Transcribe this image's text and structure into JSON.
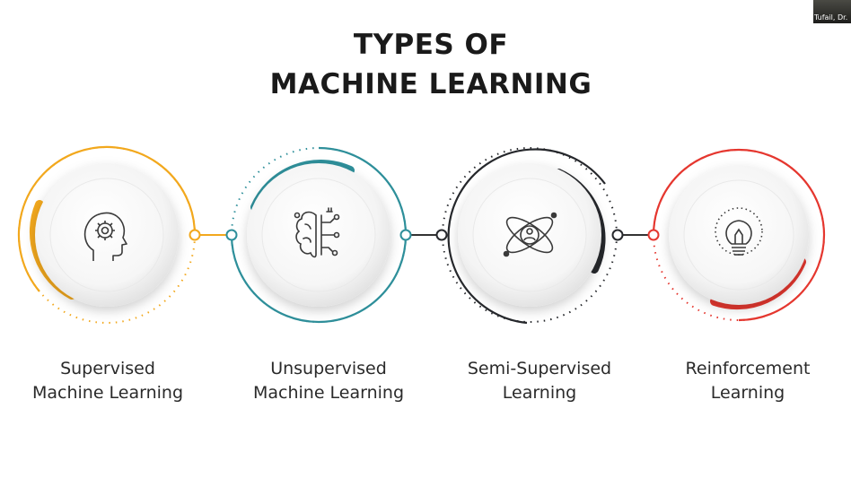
{
  "slide": {
    "title_line1": "TYPES OF",
    "title_line2": "MACHINE LEARNING",
    "connector_color": "#333333",
    "items": [
      {
        "line1": "Supervised",
        "line2": "Machine Learning",
        "accent": "#f2a81d",
        "icon": "head-gear-icon"
      },
      {
        "line1": "Unsupervised",
        "line2": "Machine Learning",
        "accent": "#2e8f9a",
        "icon": "brain-circuit-icon"
      },
      {
        "line1": "Semi-Supervised",
        "line2": "Learning",
        "accent": "#26282c",
        "icon": "atom-person-icon"
      },
      {
        "line1": "Reinforcement",
        "line2": "Learning",
        "accent": "#e5372f",
        "icon": "lightbulb-icon"
      }
    ]
  },
  "participant_video": {
    "name": "Tufail, Dr."
  }
}
